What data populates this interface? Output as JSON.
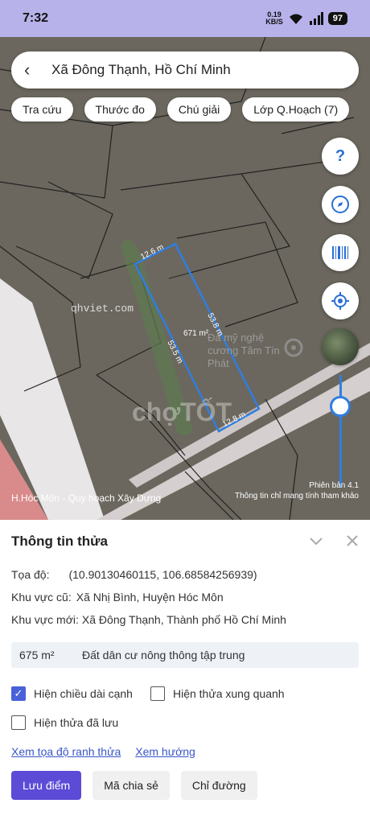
{
  "status": {
    "time": "7:32",
    "speed_value": "0.19",
    "speed_unit": "KB/S",
    "battery": "97"
  },
  "search": {
    "title": "Xã Đông Thạnh, Hồ Chí Minh"
  },
  "chips": [
    "Tra cứu",
    "Thước đo",
    "Chú giải",
    "Lớp Q.Hoạch (7)"
  ],
  "map": {
    "watermark_site": "qhviet.com",
    "watermark_brand": "chợTỐT",
    "poi": "Đá mỹ nghệ cương Tâm Tín Phát",
    "parcel_area": "671 m²",
    "edge_top": "12.6 m",
    "edge_right": "53.8 m",
    "edge_left": "53.5 m",
    "edge_bottom": "12.8 m",
    "layer_label": "H.Hóc Môn - Quy hoạch Xây Dựng",
    "version": "Phiên bản 4.1",
    "disclaimer": "Thông tin chỉ mang tính tham khảo"
  },
  "fabs": {
    "help": "?"
  },
  "info": {
    "title": "Thông tin thửa",
    "coord_label": "Tọa độ:",
    "coord_value": "(10.90130460115, 106.68584256939)",
    "old_area_label": "Khu vực cũ:",
    "old_area_value": "Xã Nhị Bình, Huyện Hóc Môn",
    "new_area_label": "Khu vực mới:",
    "new_area_value": "Xã Đông Thạnh, Thành phố Hồ Chí Minh",
    "area_value": "675 m²",
    "land_type": "Đất dân cư nông thông tập trung",
    "check_edge": "Hiện chiều dài cạnh",
    "check_neighbors": "Hiện thửa xung quanh",
    "check_saved": "Hiện thửa đã lưu",
    "link_coords": "Xem tọa độ ranh thửa",
    "link_direction": "Xem hướng",
    "btn_save": "Lưu điểm",
    "btn_share": "Mã chia sẻ",
    "btn_route": "Chỉ đường"
  },
  "colors": {
    "accent": "#5b4bd6",
    "parcel": "#2f7ee0",
    "map_bg": "#6e6a60"
  }
}
